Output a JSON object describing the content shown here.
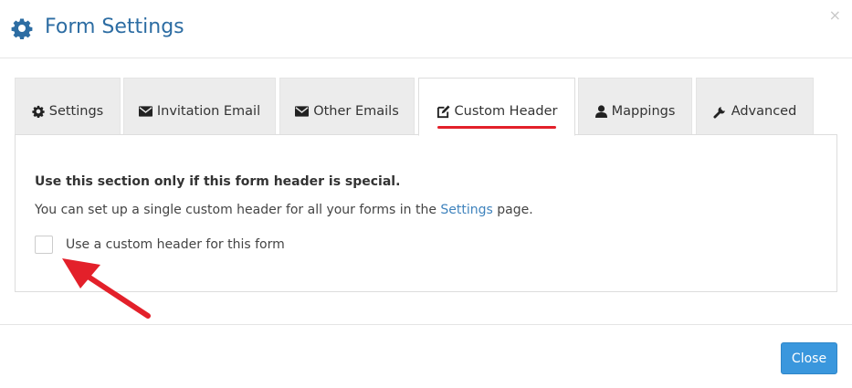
{
  "header": {
    "title": "Form Settings",
    "icon": "gear-icon",
    "close_glyph": "×"
  },
  "tabs": [
    {
      "label": "Settings",
      "icon": "gear-icon",
      "active": false
    },
    {
      "label": "Invitation Email",
      "icon": "envelope-icon",
      "active": false
    },
    {
      "label": "Other Emails",
      "icon": "envelope-icon",
      "active": false
    },
    {
      "label": "Custom Header",
      "icon": "edit-icon",
      "active": true
    },
    {
      "label": "Mappings",
      "icon": "user-icon",
      "active": false
    },
    {
      "label": "Advanced",
      "icon": "wrench-icon",
      "active": false
    }
  ],
  "panel": {
    "heading": "Use this section only if this form header is special.",
    "text_before_link": "You can set up a single custom header for all your forms in the",
    "link_label": "Settings",
    "text_after_link": "page.",
    "checkbox_label": "Use a custom header for this form",
    "checkbox_checked": false
  },
  "footer": {
    "close_label": "Close"
  },
  "colors": {
    "title": "#2d6da3",
    "link": "#3f83bd",
    "close_button": "#3a97dd",
    "annotation": "#e3202a"
  }
}
